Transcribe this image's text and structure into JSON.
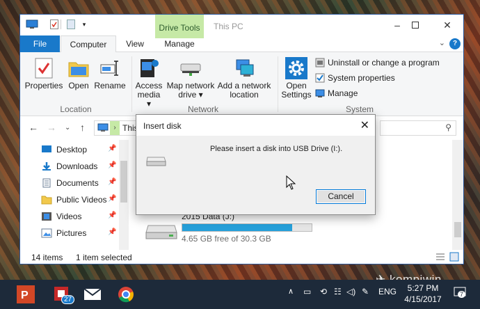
{
  "window": {
    "title": "This PC",
    "context_tab": "Drive Tools",
    "tabs": [
      "File",
      "Computer",
      "View",
      "Manage"
    ]
  },
  "ribbon": {
    "location": {
      "properties": "Properties",
      "open": "Open",
      "rename": "Rename",
      "label": "Location"
    },
    "network": {
      "access_media_1": "Access",
      "access_media_2": "media",
      "map_drive_1": "Map network",
      "map_drive_2": "drive",
      "add_loc_1": "Add a network",
      "add_loc_2": "location",
      "label": "Network"
    },
    "system": {
      "open_settings_1": "Open",
      "open_settings_2": "Settings",
      "uninstall": "Uninstall or change a program",
      "sys_props": "System properties",
      "manage": "Manage",
      "label": "System"
    }
  },
  "address": {
    "path": "This"
  },
  "sidebar": {
    "items": [
      {
        "label": "Desktop"
      },
      {
        "label": "Downloads"
      },
      {
        "label": "Documents"
      },
      {
        "label": "Public Videos"
      },
      {
        "label": "Videos"
      },
      {
        "label": "Pictures"
      }
    ]
  },
  "drive": {
    "name": "2015 Data (J:)",
    "free": "4.65 GB free of 30.3 GB",
    "used_fraction": 0.85
  },
  "status": {
    "items": "14 items",
    "selected": "1 item selected"
  },
  "dialog": {
    "title": "Insert disk",
    "message": "Please insert a disk into USB Drive (I:).",
    "cancel": "Cancel"
  },
  "taskbar": {
    "badge_count": "27",
    "lang": "ENG",
    "time": "5:27 PM",
    "date": "4/15/2017",
    "notif_count": "7"
  },
  "watermark": "kompiwin",
  "colors": {
    "accent": "#1979ca",
    "context_tab": "#c6e9a6",
    "taskbar": "#1d2a3a",
    "drive_bar": "#26a0da"
  }
}
